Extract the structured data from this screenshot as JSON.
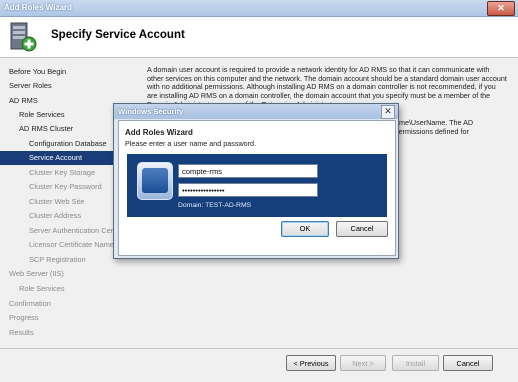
{
  "wizard": {
    "title": "Add Roles Wizard",
    "close_glyph": "✕",
    "header_title": "Specify Service Account",
    "header_icon": "server-add-role-icon"
  },
  "nav": {
    "items": [
      {
        "label": "Before You Begin",
        "state": "normal",
        "indent": 0
      },
      {
        "label": "Server Roles",
        "state": "normal",
        "indent": 0
      },
      {
        "label": "AD RMS",
        "state": "normal",
        "indent": 0
      },
      {
        "label": "Role Services",
        "state": "normal",
        "indent": 1
      },
      {
        "label": "AD RMS Cluster",
        "state": "normal",
        "indent": 1
      },
      {
        "label": "Configuration Database",
        "state": "normal",
        "indent": 2
      },
      {
        "label": "Service Account",
        "state": "selected",
        "indent": 2
      },
      {
        "label": "Cluster Key Storage",
        "state": "dim",
        "indent": 2
      },
      {
        "label": "Cluster Key Password",
        "state": "dim",
        "indent": 2
      },
      {
        "label": "Cluster Web Site",
        "state": "dim",
        "indent": 2
      },
      {
        "label": "Cluster Address",
        "state": "dim",
        "indent": 2
      },
      {
        "label": "Server Authentication Cer",
        "state": "dim",
        "indent": 2
      },
      {
        "label": "Licensor Certificate Name",
        "state": "dim",
        "indent": 2
      },
      {
        "label": "SCP Registration",
        "state": "dim",
        "indent": 2
      },
      {
        "label": "Web Server (IIS)",
        "state": "dim",
        "indent": 0
      },
      {
        "label": "Role Services",
        "state": "dim",
        "indent": 1
      },
      {
        "label": "Confirmation",
        "state": "dim",
        "indent": 0
      },
      {
        "label": "Progress",
        "state": "dim",
        "indent": 0
      },
      {
        "label": "Results",
        "state": "dim",
        "indent": 0
      }
    ]
  },
  "content": {
    "description": "A domain user account is required to provide a network identity for AD RMS so that it can communicate with other services on this computer and the network. The domain account should be a standard domain user account with no additional permissions. Although installing AD RMS on a domain controller is not recommended, if you are installing AD RMS on a domain controller, the domain account that you specify must be a member of the Domain Administrators group of the Enterprise Administrators group.",
    "tail_line1": "DomainName\\UserName. The AD",
    "tail_line2": "ve the permissions defined for"
  },
  "footer": {
    "previous": "< Previous",
    "next": "Next >",
    "install": "Install",
    "cancel": "Cancel"
  },
  "dialog": {
    "title": "Windows Security",
    "close_glyph": "✕",
    "heading": "Add Roles Wizard",
    "subheading": "Please enter a user name and password.",
    "username_value": "compte-rms",
    "password_value": "••••••••••••••••",
    "domain_label": "Domain: TEST-AD-RMS",
    "ok": "OK",
    "cancel": "Cancel",
    "accent_color": "#143f7c"
  }
}
